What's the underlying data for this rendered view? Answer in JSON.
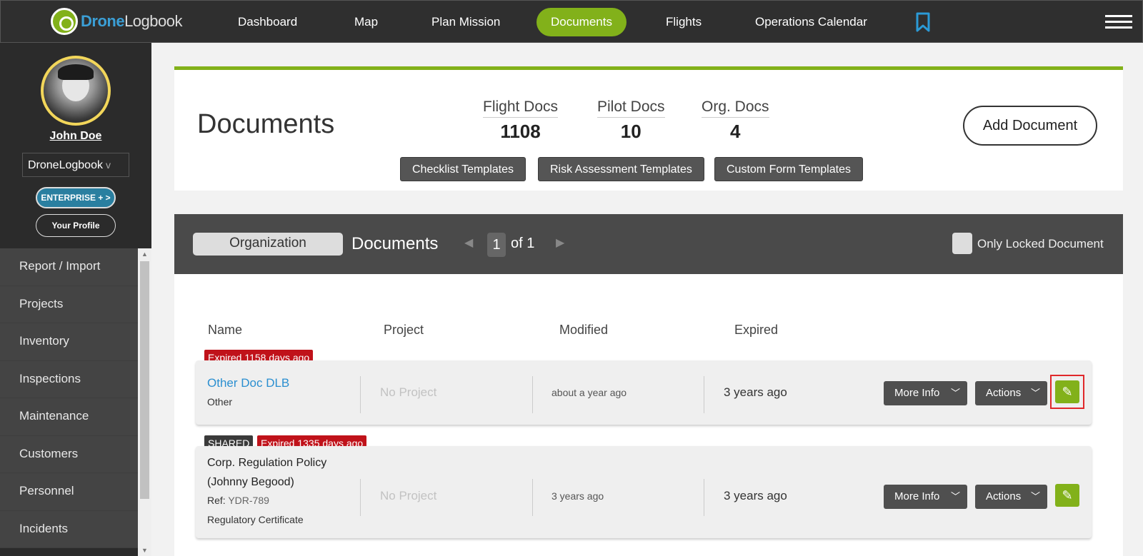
{
  "app": {
    "brand_part1": "Drone",
    "brand_part2": "Logbook",
    "accent_color": "#82b11a",
    "link_color": "#2b8fd0",
    "expired_color": "#c0121a"
  },
  "nav": {
    "items": [
      {
        "label": "Dashboard"
      },
      {
        "label": "Map"
      },
      {
        "label": "Plan Mission"
      },
      {
        "label": "Documents"
      },
      {
        "label": "Flights"
      },
      {
        "label": "Operations Calendar"
      }
    ],
    "active": "Documents",
    "bookmark_icon": "bookmark-icon",
    "menu_icon": "hamburger-icon"
  },
  "sidebar": {
    "user_name": "John Doe",
    "org_name": "DroneLogbook",
    "org_chevron": "v",
    "enterprise_label": "ENTERPRISE + >",
    "profile_label": "Your Profile",
    "menu": [
      {
        "label": "Report / Import"
      },
      {
        "label": "Projects"
      },
      {
        "label": "Inventory"
      },
      {
        "label": "Inspections"
      },
      {
        "label": "Maintenance"
      },
      {
        "label": "Customers"
      },
      {
        "label": "Personnel"
      },
      {
        "label": "Incidents"
      }
    ]
  },
  "header": {
    "title": "Documents",
    "stats": [
      {
        "label": "Flight Docs",
        "value": "1108"
      },
      {
        "label": "Pilot Docs",
        "value": "10"
      },
      {
        "label": "Org. Docs",
        "value": "4"
      }
    ],
    "template_buttons": [
      {
        "label": "Checklist Templates"
      },
      {
        "label": "Risk Assessment Templates"
      },
      {
        "label": "Custom Form Templates"
      }
    ],
    "add_button": "Add Document"
  },
  "list": {
    "segment": "Organization",
    "title": "Documents",
    "page": "1",
    "page_of": "of 1",
    "locked_label": "Only Locked Document",
    "columns": [
      "Name",
      "Project",
      "Modified",
      "Expired"
    ],
    "rows": [
      {
        "expired_badge": "Expired 1158 days ago",
        "name": "Other Doc DLB",
        "type": "Other",
        "project": "No Project",
        "modified": "about a year ago",
        "expired": "3 years ago",
        "more_info": "More Info",
        "actions": "Actions"
      },
      {
        "shared_badge": "SHARED",
        "expired_badge": "Expired 1335 days ago",
        "name_line1": "Corp. Regulation Policy",
        "name_line2": "(Johnny Begood)",
        "ref_label": "Ref:",
        "ref_value": "YDR-789",
        "type": "Regulatory Certificate",
        "project": "No Project",
        "modified": "3 years ago",
        "expired": "3 years ago",
        "more_info": "More Info",
        "actions": "Actions"
      }
    ]
  }
}
